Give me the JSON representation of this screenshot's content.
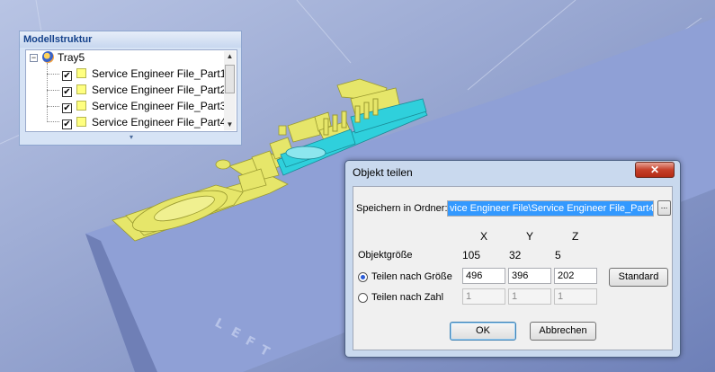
{
  "model_panel": {
    "title": "Modellstruktur",
    "root": {
      "label": "Tray5",
      "expander": "−"
    },
    "items": [
      {
        "label": "Service Engineer File_Part1",
        "checked": "✔"
      },
      {
        "label": "Service Engineer File_Part2",
        "checked": "✔"
      },
      {
        "label": "Service Engineer File_Part3",
        "checked": "✔"
      },
      {
        "label": "Service Engineer File_Part4",
        "checked": "✔"
      }
    ],
    "footer_glyph": "▾"
  },
  "dialog": {
    "title": "Objekt teilen",
    "close_glyph": "✕",
    "save_folder_label": "Speichern in Ordner:",
    "save_folder_value": "vice Engineer File\\Service Engineer File_Part4",
    "browse_label": "...",
    "headers": {
      "x": "X",
      "y": "Y",
      "z": "Z"
    },
    "object_size": {
      "label": "Objektgröße",
      "x": "105",
      "y": "32",
      "z": "5"
    },
    "split_by_size": {
      "label": "Teilen nach Größe",
      "x": "496",
      "y": "396",
      "z": "202",
      "selected": true
    },
    "split_by_count": {
      "label": "Teilen nach Zahl",
      "x": "1",
      "y": "1",
      "z": "1",
      "selected": false
    },
    "standard_label": "Standard",
    "ok_label": "OK",
    "cancel_label": "Abbrechen"
  },
  "colors": {
    "part_yellow": "#e6e66a",
    "part_cyan": "#2fd0dc",
    "platform": "#8fa0d6",
    "background": "#7a8cc0"
  }
}
